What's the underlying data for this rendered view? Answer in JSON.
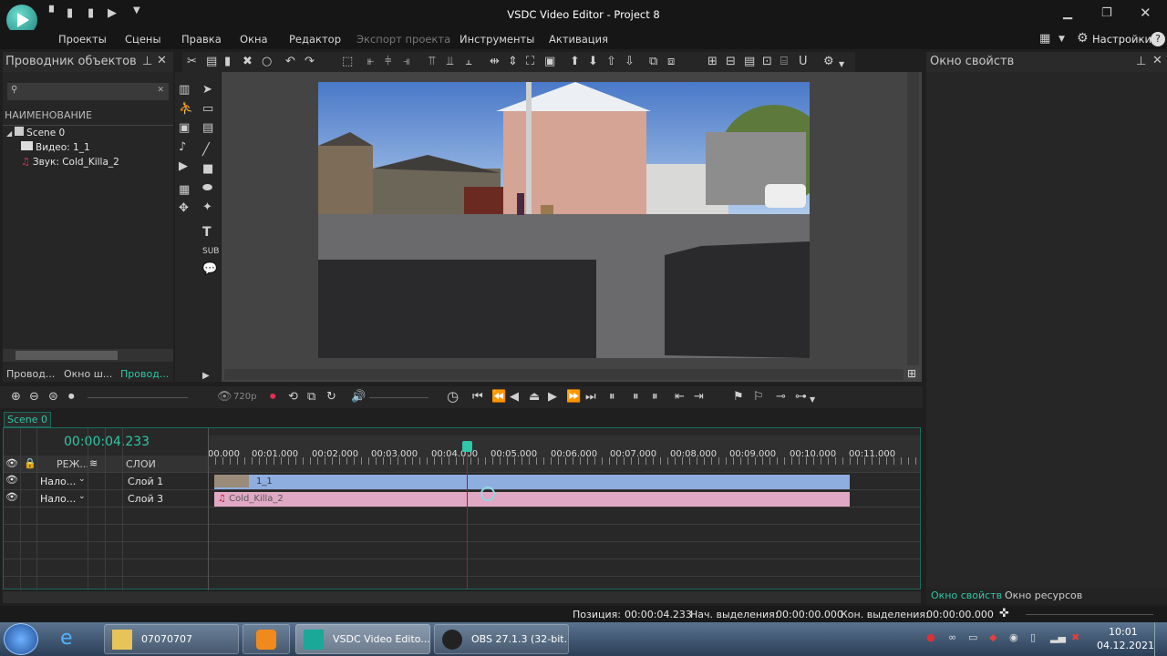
{
  "app": {
    "title": "VSDC Video Editor - Project 8"
  },
  "menu": {
    "items": [
      "Проекты",
      "Сцены",
      "Правка",
      "Окна",
      "Редактор",
      "Экспорт проекта",
      "Инструменты",
      "Активация"
    ],
    "settings": "Настройки"
  },
  "explorer": {
    "title": "Проводник объектов",
    "column_header": "НАИМЕНОВАНИЕ",
    "tree": [
      "Scene 0",
      "Видео: 1_1",
      "Звук: Cold_Killa_2"
    ],
    "tabs": [
      "Провод...",
      "Окно ш...",
      "Провод..."
    ]
  },
  "properties": {
    "title": "Окно свойств",
    "tabs": [
      "Окно свойств",
      "Окно ресурсов"
    ]
  },
  "preview": {
    "quality": "720p"
  },
  "timeline": {
    "scene_tab": "Scene 0",
    "time": "00:00:04.233",
    "header": {
      "mode": "РЕЖ...",
      "layers": "СЛОИ"
    },
    "ruler": [
      "00.000",
      "00:01.000",
      "00:02.000",
      "00:03.000",
      "00:04.000",
      "00:05.000",
      "00:06.000",
      "00:07.000",
      "00:08.000",
      "00:09.000",
      "00:10.000",
      "00:11.000"
    ],
    "tracks": [
      {
        "mode": "Нало...",
        "layer": "Слой 1",
        "clip": "1_1",
        "color": "#8eaee0"
      },
      {
        "mode": "Нало...",
        "layer": "Слой 3",
        "clip": "Cold_Killa_2",
        "color": "#e0a8c4"
      }
    ]
  },
  "status": {
    "position_label": "Позиция:",
    "position": "00:00:04.233",
    "sel_start_label": "Нач. выделения:",
    "sel_start": "00:00:00.000",
    "sel_end_label": "Кон. выделения:",
    "sel_end": "00:00:00.000"
  },
  "taskbar": {
    "items": [
      "07070707",
      "",
      "VSDC Video Edito...",
      "OBS 27.1.3 (32-bit..."
    ],
    "time": "10:01",
    "date": "04.12.2021"
  },
  "colors": {
    "accent": "#2fc7a6",
    "playhead": "#c0102a"
  }
}
